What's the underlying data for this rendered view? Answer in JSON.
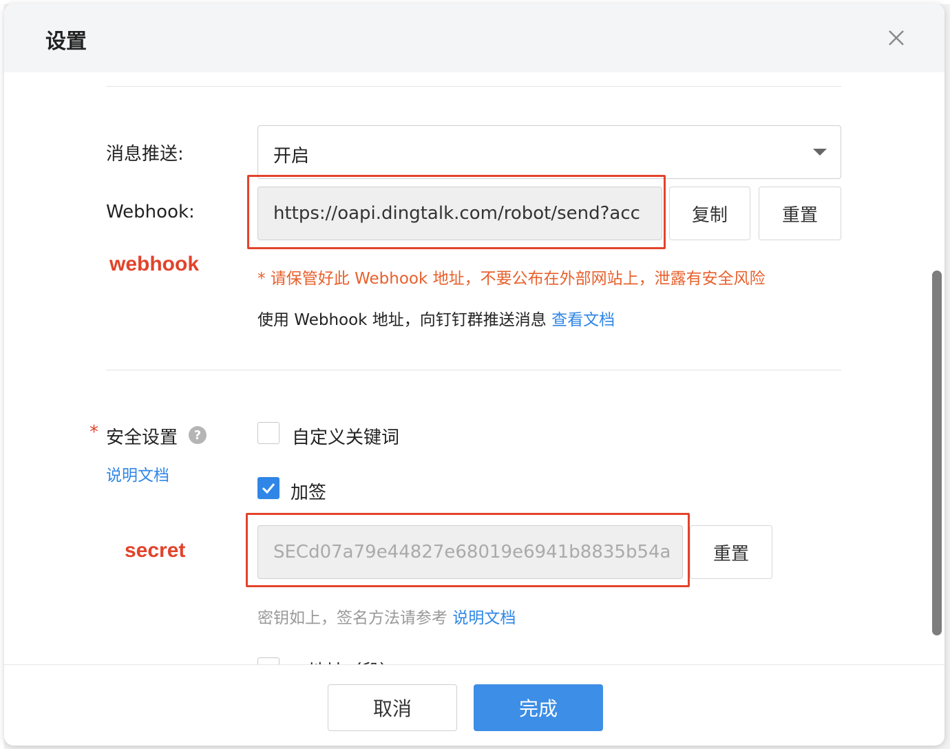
{
  "modal": {
    "title": "设置"
  },
  "push": {
    "label": "消息推送:",
    "value": "开启"
  },
  "webhook": {
    "label": "Webhook:",
    "url": "https://oapi.dingtalk.com/robot/send?acc",
    "copy_label": "复制",
    "reset_label": "重置",
    "warning": "* 请保管好此 Webhook 地址，不要公布在外部网站上，泄露有安全风险",
    "info": "使用 Webhook 地址，向钉钉群推送消息",
    "doc_link": "查看文档"
  },
  "annotations": {
    "webhook": "webhook",
    "secret": "secret"
  },
  "security": {
    "required_mark": "*",
    "label": "安全设置",
    "help_icon": "?",
    "doc_link": "说明文档",
    "options": [
      {
        "label": "自定义关键词",
        "checked": false
      },
      {
        "label": "加签",
        "checked": true
      }
    ],
    "secret_value": "SECd07a79e44827e68019e6941b8835b54a",
    "secret_reset_label": "重置",
    "secret_hint": "密钥如上，签名方法请参考",
    "secret_hint_link": "说明文档",
    "ip_option_label": "IP地址（段）"
  },
  "footer": {
    "cancel_label": "取消",
    "done_label": "完成"
  },
  "colors": {
    "accent": "#2f86e6",
    "primary_button": "#3d8ee6",
    "warning": "#e8602c",
    "annotation": "#e2432b"
  }
}
